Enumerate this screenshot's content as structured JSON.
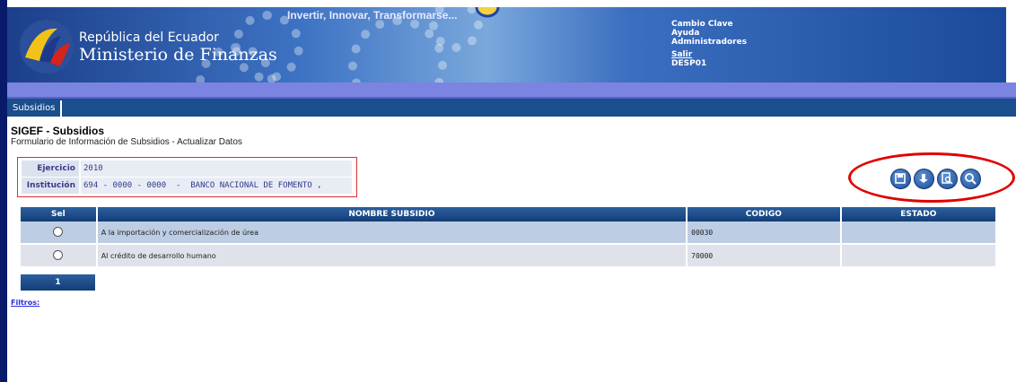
{
  "header": {
    "org_line1": "República del Ecuador",
    "org_line2": "Ministerio de Finanzas",
    "slogan": "Invertir, Innovar, Transformarse...",
    "links": {
      "change_password": "Cambio Clave",
      "help": "Ayuda",
      "admins": "Administradores",
      "logout": "Salir",
      "user": "DESP01"
    }
  },
  "tabs": [
    {
      "label": "Subsidios"
    }
  ],
  "page": {
    "title": "SIGEF - Subsidios",
    "subtitle": "Formulario de Información de Subsidios - Actualizar Datos"
  },
  "info": {
    "ejercicio_label": "Ejercicio",
    "ejercicio_value": "2010",
    "institucion_label": "Institución",
    "institucion_code": "694 - 0000 - 0000",
    "institucion_sep": "-",
    "institucion_name": "BANCO NACIONAL DE FOMENTO ,"
  },
  "toolbar": {
    "icons": [
      "save-icon",
      "download-icon",
      "search-document-icon",
      "search-icon"
    ]
  },
  "grid": {
    "headers": [
      "Sel",
      "NOMBRE SUBSIDIO",
      "CODIGO",
      "ESTADO"
    ],
    "rows": [
      {
        "nombre": "A la importación y comercialización de úrea",
        "codigo": "00030",
        "estado": ""
      },
      {
        "nombre": "Al crédito de desarrollo humano",
        "codigo": "70000",
        "estado": ""
      }
    ],
    "page": "1"
  },
  "filters_label": "Filtros:",
  "colors": {
    "header_blue": "#1a4e8c",
    "purple_bar": "#7b84e0",
    "row_odd": "#bdcde3",
    "row_even": "#dfe2ea",
    "highlight_red": "#e00000"
  }
}
